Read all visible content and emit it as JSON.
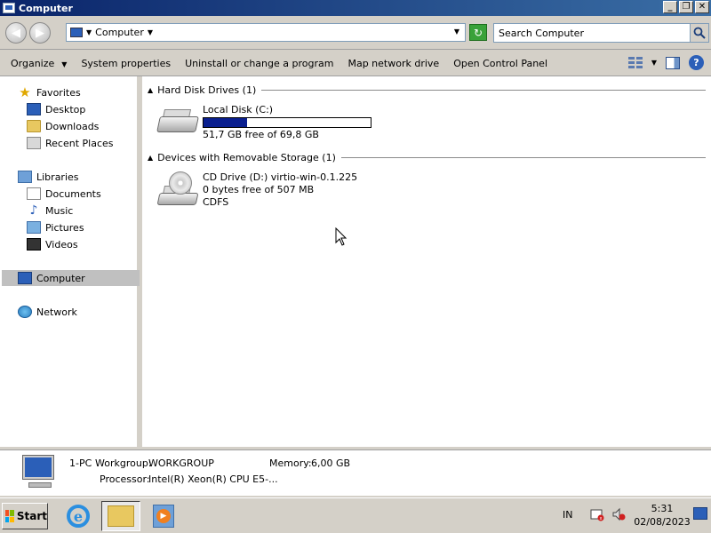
{
  "window": {
    "title": "Computer"
  },
  "address": {
    "path_label": "Computer"
  },
  "search": {
    "placeholder": "Search Computer"
  },
  "toolbar": {
    "organize": "Organize",
    "system_properties": "System properties",
    "uninstall": "Uninstall or change a program",
    "map_drive": "Map network drive",
    "control_panel": "Open Control Panel"
  },
  "sidebar": {
    "favorites": "Favorites",
    "desktop": "Desktop",
    "downloads": "Downloads",
    "recent_places": "Recent Places",
    "libraries": "Libraries",
    "documents": "Documents",
    "music": "Music",
    "pictures": "Pictures",
    "videos": "Videos",
    "computer": "Computer",
    "network": "Network"
  },
  "groups": {
    "hdd_header": "Hard Disk Drives (1)",
    "removable_header": "Devices with Removable Storage (1)"
  },
  "drives": {
    "local_disk": {
      "name": "Local Disk (C:)",
      "free_text": "51,7 GB free of 69,8 GB",
      "used_fraction": 0.26
    },
    "cd_drive": {
      "name": "CD Drive (D:) virtio-win-0.1.225",
      "free_text": "0 bytes free of 507 MB",
      "fs": "CDFS"
    }
  },
  "details": {
    "pc_name": "1-PC",
    "workgroup_label": "Workgroup:",
    "workgroup_value": "WORKGROUP",
    "memory_label": "Memory:",
    "memory_value": "6,00 GB",
    "processor_label": "Processor:",
    "processor_value": "Intel(R) Xeon(R) CPU E5-..."
  },
  "taskbar": {
    "start_label": "Start",
    "lang": "IN",
    "time": "5:31",
    "date": "02/08/2023"
  },
  "icons": {
    "search": "magnifier-icon",
    "help": "help-icon",
    "refresh": "refresh-icon"
  },
  "colors": {
    "capacity_fill": "#0a1f8f",
    "title_bar": "#0a246a"
  }
}
